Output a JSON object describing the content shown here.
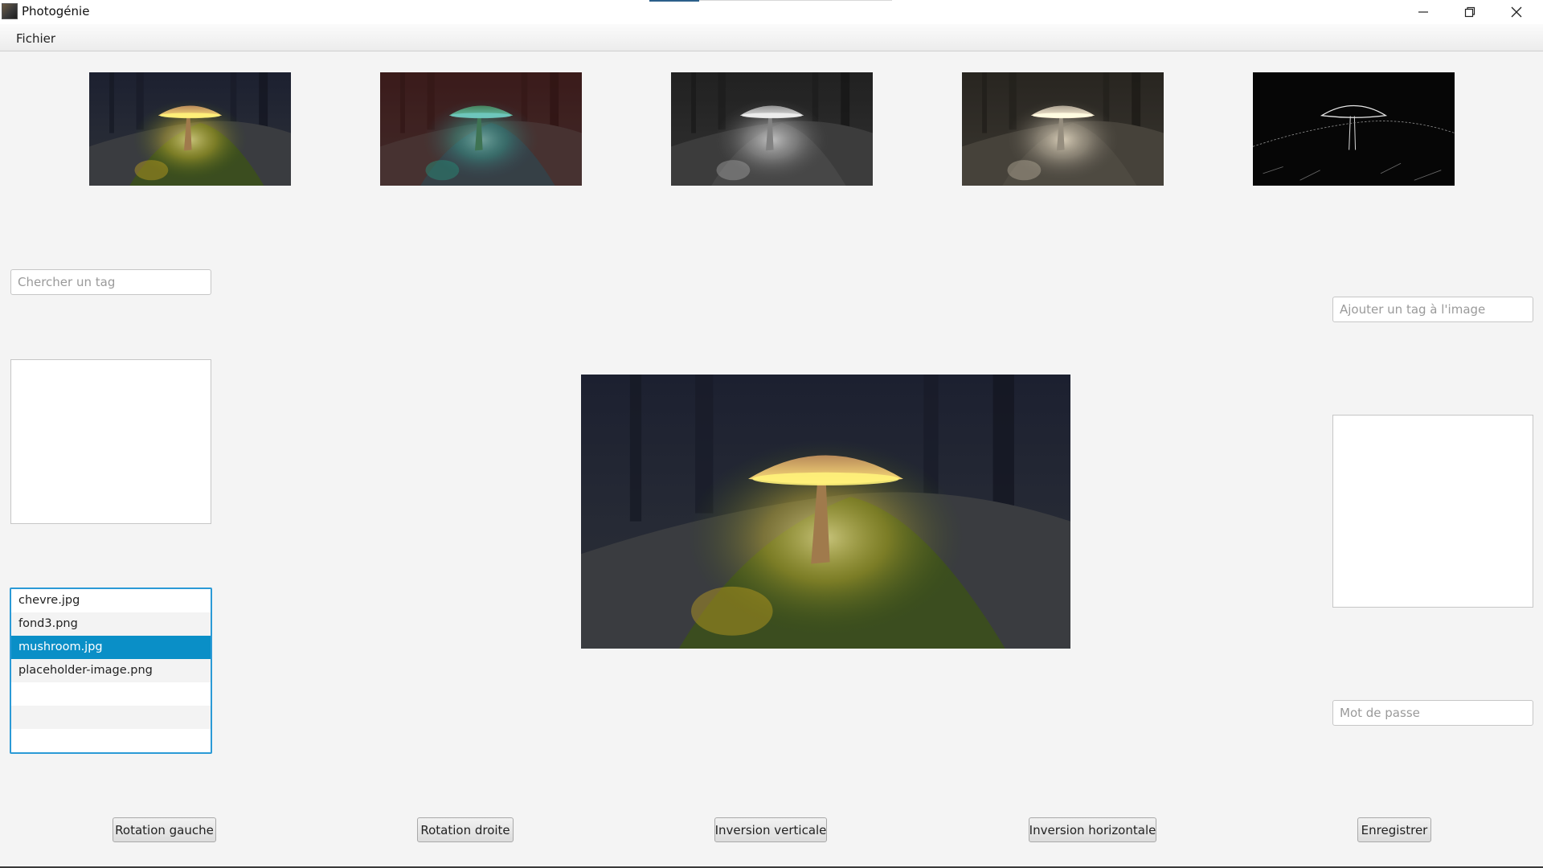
{
  "window": {
    "title": "Photogénie",
    "icons": {
      "app": "app-photo-icon",
      "minimize": "minimize-icon",
      "maximize": "restore-icon",
      "close": "close-icon"
    }
  },
  "menu": {
    "items": [
      {
        "label": "Fichier"
      }
    ]
  },
  "thumbnails": [
    {
      "filter": "original"
    },
    {
      "filter": "color-shift"
    },
    {
      "filter": "grayscale"
    },
    {
      "filter": "sepia"
    },
    {
      "filter": "edge-detect"
    }
  ],
  "search": {
    "placeholder": "Chercher un tag"
  },
  "tagging": {
    "placeholder": "Ajouter un tag à l'image"
  },
  "password": {
    "placeholder": "Mot de passe"
  },
  "files": {
    "items": [
      "chevre.jpg",
      "fond3.png",
      "mushroom.jpg",
      "placeholder-image.png"
    ],
    "selected": "mushroom.jpg"
  },
  "buttons": {
    "rotate_left": "Rotation gauche",
    "rotate_right": "Rotation droite",
    "flip_vertical": "Inversion verticale",
    "flip_horizontal": "Inversion horizontale",
    "save": "Enregistrer"
  },
  "colors": {
    "accent": "#2b9ad6",
    "selection": "#0a8fc7",
    "background": "#f4f4f4"
  }
}
